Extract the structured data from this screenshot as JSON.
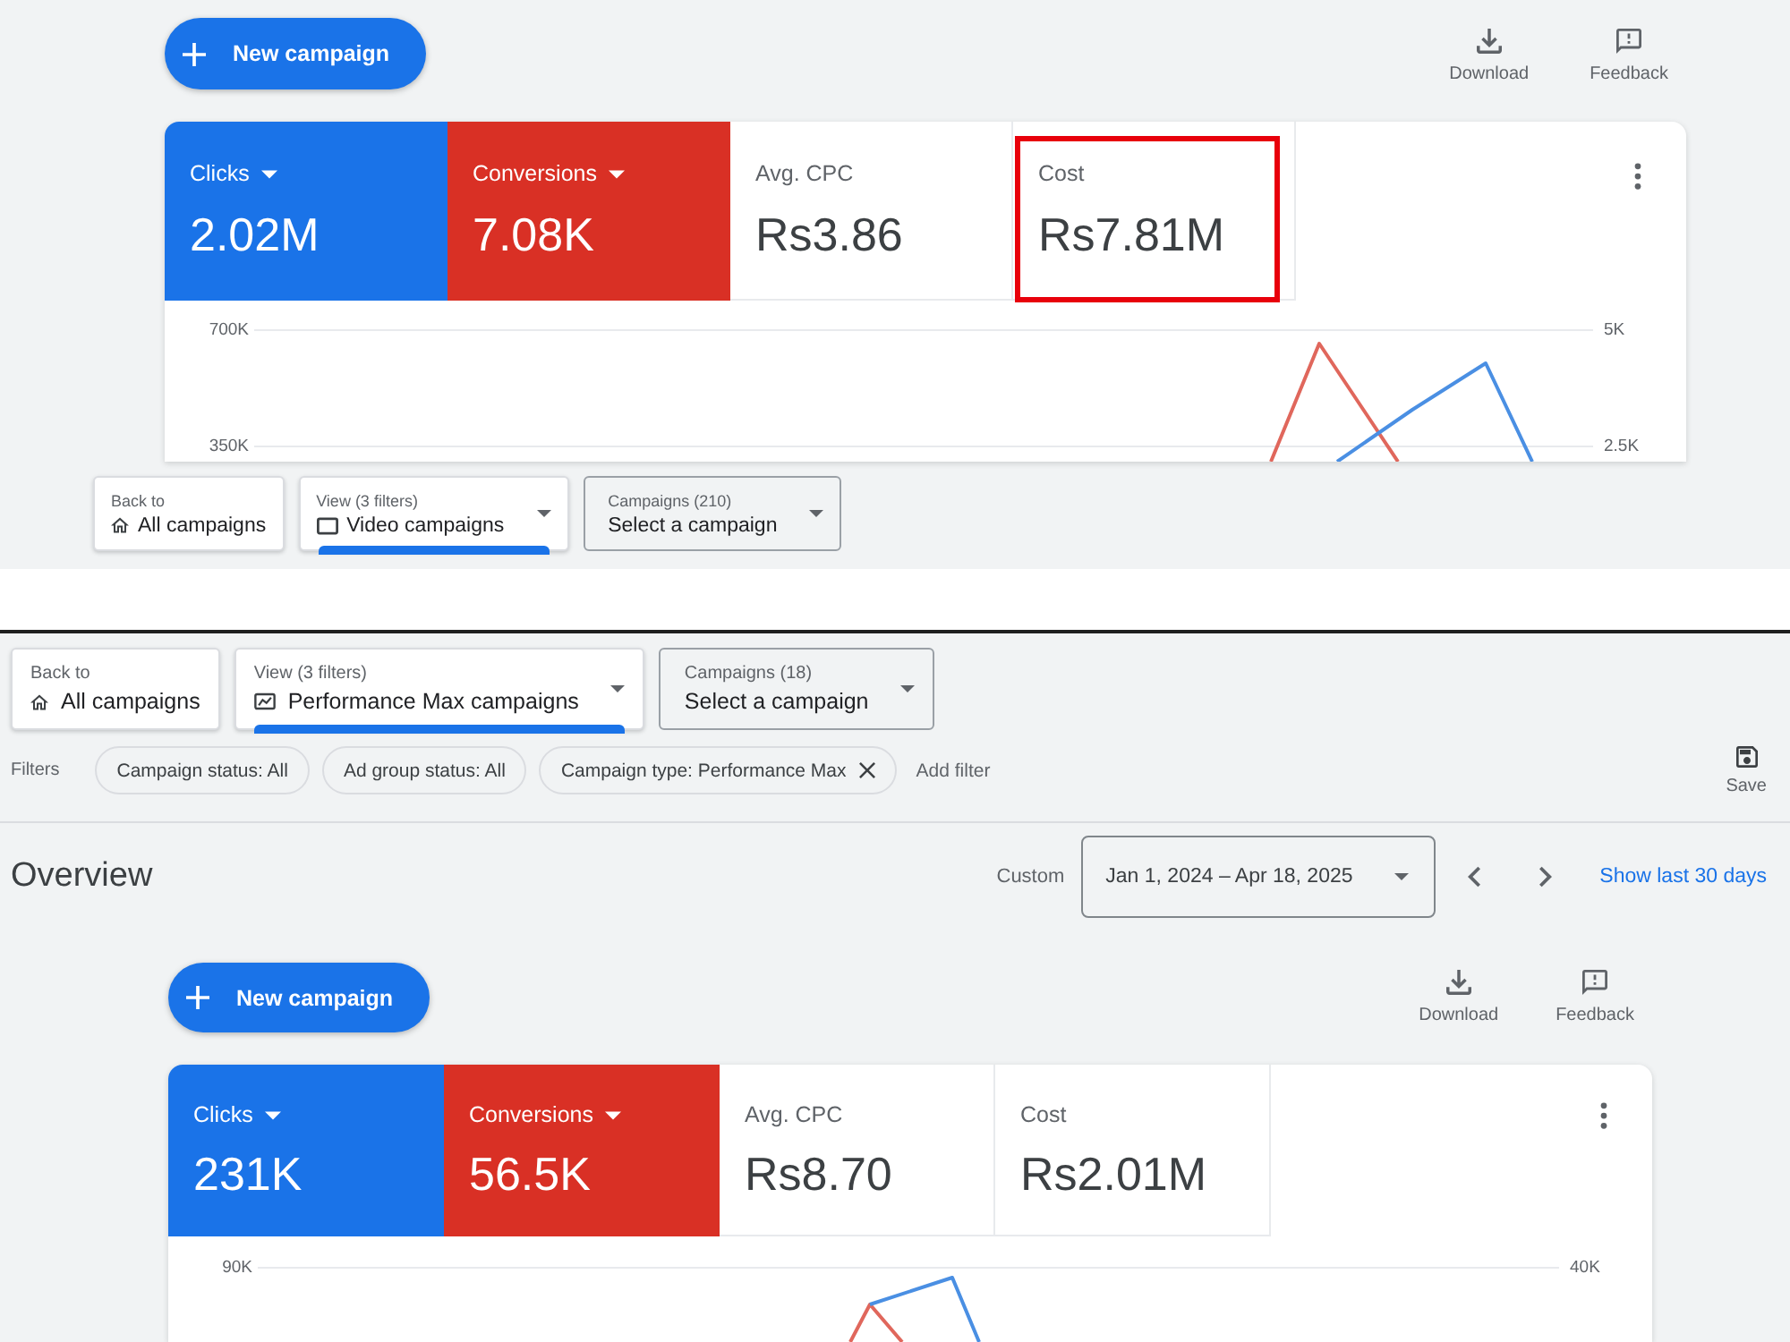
{
  "panels": [
    {
      "sections": [
        {
          "kind": "summary",
          "new_campaign": "New campaign",
          "actions": [
            {
              "kind": "download",
              "label": "Download"
            },
            {
              "kind": "feedback",
              "label": "Feedback"
            }
          ],
          "metrics": [
            {
              "label": "Clicks",
              "value": "2.02M",
              "selected": true,
              "color": "#1a73e8",
              "highlighted": false
            },
            {
              "label": "Conversions",
              "value": "7.08K",
              "selected": true,
              "color": "#d93025",
              "highlighted": false
            },
            {
              "label": "Avg. CPC",
              "value": "Rs3.86",
              "selected": false,
              "highlighted": false
            },
            {
              "label": "Cost",
              "value": "Rs7.81M",
              "selected": false,
              "highlighted": true
            }
          ],
          "chart": {
            "left_ticks": [
              "700K",
              "350K"
            ],
            "right_ticks": [
              "5K",
              "2.5K"
            ]
          }
        },
        {
          "kind": "nav",
          "items": [
            {
              "kind": "back",
              "caption": "Back to",
              "label": "All campaigns",
              "selected": false
            },
            {
              "kind": "video-view",
              "caption": "View (3 filters)",
              "label": "Video campaigns",
              "selected": true
            },
            {
              "kind": "campaigns",
              "caption": "Campaigns (210)",
              "label": "Select a campaign",
              "selected": false
            }
          ]
        }
      ]
    },
    {
      "sections": [
        {
          "kind": "nav",
          "items": [
            {
              "kind": "back",
              "caption": "Back to",
              "label": "All campaigns",
              "selected": false
            },
            {
              "kind": "pmax-view",
              "caption": "View (3 filters)",
              "label": "Performance Max campaigns",
              "selected": true
            },
            {
              "kind": "campaigns",
              "caption": "Campaigns (18)",
              "label": "Select a campaign",
              "selected": false
            }
          ]
        },
        {
          "kind": "filters",
          "label": "Filters",
          "chips": [
            {
              "label": "Campaign status: All",
              "removable": false
            },
            {
              "label": "Ad group status: All",
              "removable": false
            },
            {
              "label": "Campaign type: Performance Max",
              "removable": true
            }
          ],
          "add_filter": "Add filter",
          "save": "Save"
        },
        {
          "kind": "overview",
          "title": "Overview",
          "range_label": "Custom",
          "date_range": "Jan 1, 2024 – Apr 18, 2025",
          "link": "Show last 30 days"
        },
        {
          "kind": "summary",
          "new_campaign": "New campaign",
          "actions": [
            {
              "kind": "download",
              "label": "Download"
            },
            {
              "kind": "feedback",
              "label": "Feedback"
            }
          ],
          "metrics": [
            {
              "label": "Clicks",
              "value": "231K",
              "selected": true,
              "color": "#1a73e8",
              "highlighted": false
            },
            {
              "label": "Conversions",
              "value": "56.5K",
              "selected": true,
              "color": "#d93025",
              "highlighted": false
            },
            {
              "label": "Avg. CPC",
              "value": "Rs8.70",
              "selected": false,
              "highlighted": false
            },
            {
              "label": "Cost",
              "value": "Rs2.01M",
              "selected": false,
              "highlighted": false
            }
          ],
          "chart": {
            "left_ticks": [
              "90K"
            ],
            "right_ticks": [
              "40K"
            ]
          }
        }
      ]
    }
  ]
}
